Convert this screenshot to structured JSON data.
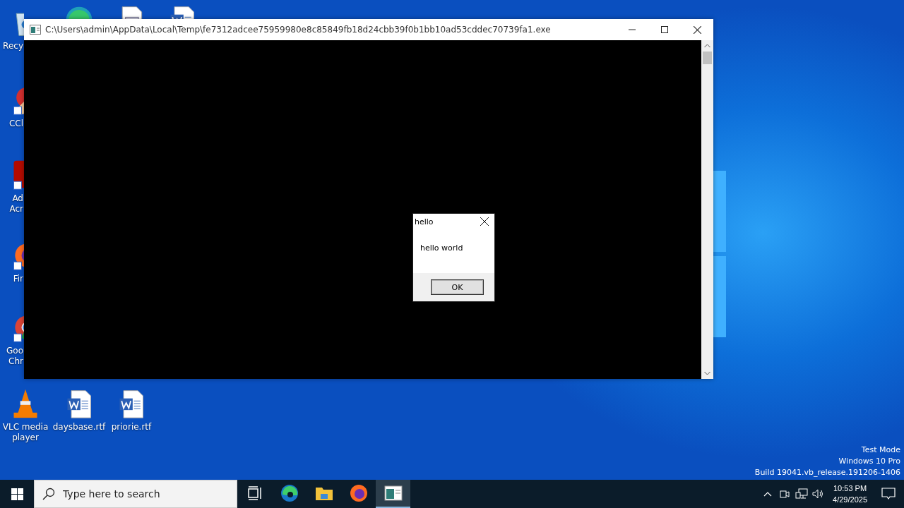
{
  "desktop_icons": [
    {
      "kind": "recycle",
      "lines": [
        "Recy"
      ]
    },
    {
      "kind": "edge"
    },
    {
      "kind": "document"
    },
    {
      "kind": "word"
    },
    {
      "kind": "ccleaner",
      "lines": [
        "CCl"
      ]
    },
    {
      "kind": "acrobat",
      "lines": [
        "Ad",
        "Acr"
      ]
    },
    {
      "kind": "firefox",
      "lines": [
        "Fir"
      ]
    },
    {
      "kind": "chrome",
      "lines": [
        "Goo",
        "Chr"
      ]
    },
    {
      "kind": "vlc",
      "lines": [
        "VLC media",
        "player"
      ]
    },
    {
      "kind": "word",
      "lines": [
        "daysbase.rtf"
      ]
    },
    {
      "kind": "word",
      "lines": [
        "priorie.rtf"
      ]
    }
  ],
  "window": {
    "title": "C:\\Users\\admin\\AppData\\Local\\Temp\\fe7312adcee75959980e8c85849fb18d24cbb39f0b1bb10ad53cddec70739fa1.exe"
  },
  "dialog": {
    "title": "hello",
    "message": "hello world",
    "button": "OK"
  },
  "system_text": [
    "Test Mode",
    "Windows 10 Pro",
    "Build 19041.vb_release.191206-1406"
  ],
  "taskbar": {
    "search": {
      "placeholder": "Type here to search"
    },
    "apps": [
      {
        "kind": "taskview",
        "selected": false
      },
      {
        "kind": "edge",
        "selected": false
      },
      {
        "kind": "explorer",
        "selected": false
      },
      {
        "kind": "firefox",
        "selected": false
      },
      {
        "kind": "console",
        "selected": true
      }
    ],
    "time": "10:53 PM",
    "date": "4/29/2025"
  }
}
